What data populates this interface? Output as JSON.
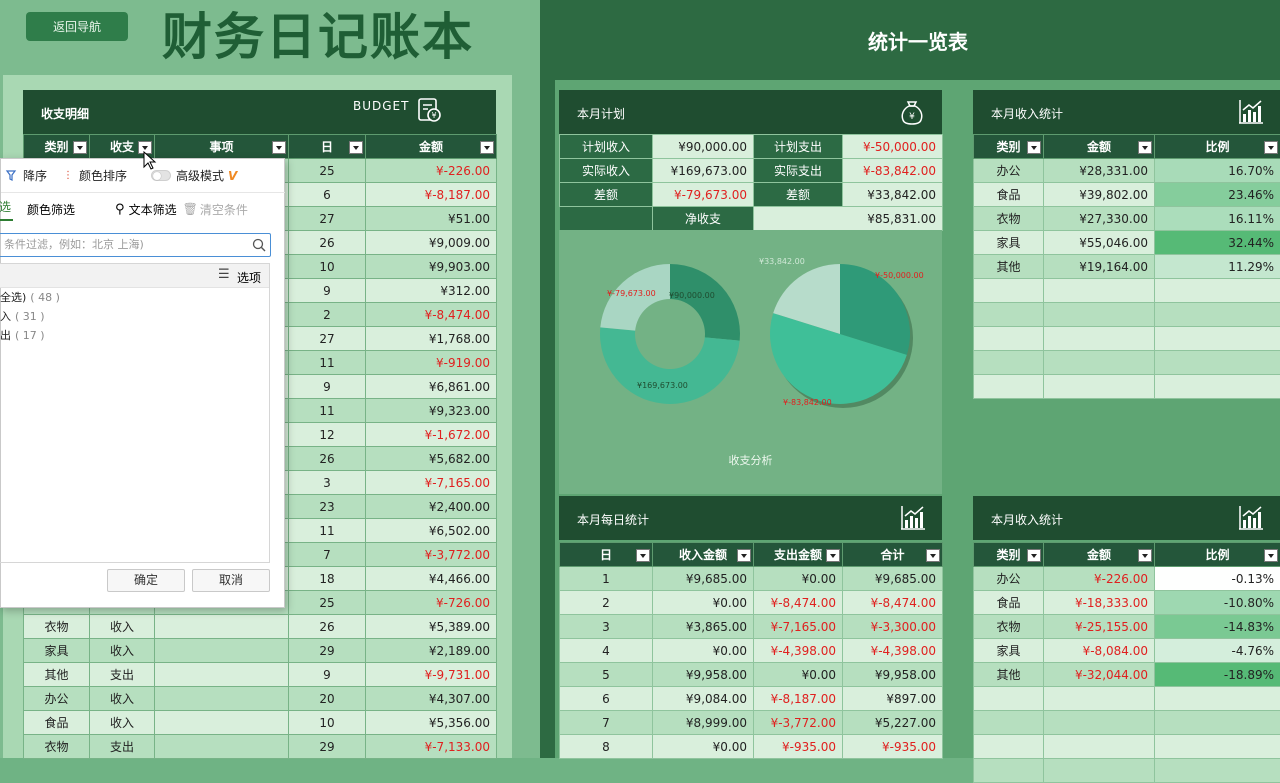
{
  "header": {
    "back_button": "返回导航",
    "title": "财务日记账本"
  },
  "ledger": {
    "section_title": "收支明细",
    "badge": "BUDGET",
    "columns": [
      "类别",
      "收支",
      "事项",
      "日",
      "金额"
    ],
    "rows": [
      {
        "c": "",
        "t": "",
        "day": "25",
        "amt": "¥-226.00"
      },
      {
        "c": "",
        "t": "",
        "day": "6",
        "amt": "¥-8,187.00"
      },
      {
        "c": "",
        "t": "",
        "day": "27",
        "amt": "¥51.00"
      },
      {
        "c": "",
        "t": "",
        "day": "26",
        "amt": "¥9,009.00"
      },
      {
        "c": "",
        "t": "",
        "day": "10",
        "amt": "¥9,903.00"
      },
      {
        "c": "",
        "t": "",
        "day": "9",
        "amt": "¥312.00"
      },
      {
        "c": "",
        "t": "",
        "day": "2",
        "amt": "¥-8,474.00"
      },
      {
        "c": "",
        "t": "",
        "day": "27",
        "amt": "¥1,768.00"
      },
      {
        "c": "",
        "t": "",
        "day": "11",
        "amt": "¥-919.00"
      },
      {
        "c": "",
        "t": "",
        "day": "9",
        "amt": "¥6,861.00"
      },
      {
        "c": "",
        "t": "",
        "day": "11",
        "amt": "¥9,323.00"
      },
      {
        "c": "",
        "t": "",
        "day": "12",
        "amt": "¥-1,672.00"
      },
      {
        "c": "",
        "t": "",
        "day": "26",
        "amt": "¥5,682.00"
      },
      {
        "c": "",
        "t": "",
        "day": "3",
        "amt": "¥-7,165.00"
      },
      {
        "c": "",
        "t": "",
        "day": "23",
        "amt": "¥2,400.00"
      },
      {
        "c": "",
        "t": "",
        "day": "11",
        "amt": "¥6,502.00"
      },
      {
        "c": "",
        "t": "",
        "day": "7",
        "amt": "¥-3,772.00"
      },
      {
        "c": "",
        "t": "",
        "day": "18",
        "amt": "¥4,466.00"
      },
      {
        "c": "",
        "t": "",
        "day": "25",
        "amt": "¥-726.00"
      },
      {
        "c": "衣物",
        "t": "收入",
        "day": "26",
        "amt": "¥5,389.00"
      },
      {
        "c": "家具",
        "t": "收入",
        "day": "29",
        "amt": "¥2,189.00"
      },
      {
        "c": "其他",
        "t": "支出",
        "day": "9",
        "amt": "¥-9,731.00"
      },
      {
        "c": "办公",
        "t": "收入",
        "day": "20",
        "amt": "¥4,307.00"
      },
      {
        "c": "食品",
        "t": "收入",
        "day": "10",
        "amt": "¥5,356.00"
      },
      {
        "c": "衣物",
        "t": "支出",
        "day": "29",
        "amt": "¥-7,133.00"
      }
    ]
  },
  "filter_popup": {
    "sort_desc": "降序",
    "color_sort": "颜色排序",
    "advanced": "高级模式",
    "content_tab": "选",
    "color_filter": "颜色筛选",
    "text_filter": "文本筛选",
    "clear": "清空条件",
    "search_placeholder": "条件过滤，例如：北京 上海)",
    "options_label": "选项",
    "items": [
      {
        "label": "全选)",
        "count": "( 48 )"
      },
      {
        "label": "入",
        "count": "( 31 )"
      },
      {
        "label": "出",
        "count": "( 17 )"
      }
    ],
    "ok": "确定",
    "cancel": "取消"
  },
  "stats": {
    "title": "统计一览表",
    "plan": {
      "title": "本月计划",
      "rows": [
        {
          "l1": "计划收入",
          "v1": "¥90,000.00",
          "l2": "计划支出",
          "v2": "¥-50,000.00"
        },
        {
          "l1": "实际收入",
          "v1": "¥169,673.00",
          "l2": "实际支出",
          "v2": "¥-83,842.00"
        },
        {
          "l1": "差额",
          "v1": "¥-79,673.00",
          "l2": "差额",
          "v2": "¥33,842.00"
        }
      ],
      "net_label": "净收支",
      "net_value": "¥85,831.00"
    },
    "chart_caption": "收支分析",
    "income1": {
      "title": "本月收入统计",
      "columns": [
        "类别",
        "金额",
        "比例"
      ],
      "rows": [
        {
          "c": "办公",
          "a": "¥28,331.00",
          "p": "16.70%"
        },
        {
          "c": "食品",
          "a": "¥39,802.00",
          "p": "23.46%"
        },
        {
          "c": "衣物",
          "a": "¥27,330.00",
          "p": "16.11%"
        },
        {
          "c": "家具",
          "a": "¥55,046.00",
          "p": "32.44%"
        },
        {
          "c": "其他",
          "a": "¥19,164.00",
          "p": "11.29%"
        }
      ]
    },
    "daily": {
      "title": "本月每日统计",
      "columns": [
        "日",
        "收入金额",
        "支出金额",
        "合计"
      ],
      "rows": [
        {
          "d": "1",
          "i": "¥9,685.00",
          "e": "¥0.00",
          "s": "¥9,685.00"
        },
        {
          "d": "2",
          "i": "¥0.00",
          "e": "¥-8,474.00",
          "s": "¥-8,474.00"
        },
        {
          "d": "3",
          "i": "¥3,865.00",
          "e": "¥-7,165.00",
          "s": "¥-3,300.00"
        },
        {
          "d": "4",
          "i": "¥0.00",
          "e": "¥-4,398.00",
          "s": "¥-4,398.00"
        },
        {
          "d": "5",
          "i": "¥9,958.00",
          "e": "¥0.00",
          "s": "¥9,958.00"
        },
        {
          "d": "6",
          "i": "¥9,084.00",
          "e": "¥-8,187.00",
          "s": "¥897.00"
        },
        {
          "d": "7",
          "i": "¥8,999.00",
          "e": "¥-3,772.00",
          "s": "¥5,227.00"
        },
        {
          "d": "8",
          "i": "¥0.00",
          "e": "¥-935.00",
          "s": "¥-935.00"
        }
      ]
    },
    "income2": {
      "title": "本月收入统计",
      "columns": [
        "类别",
        "金额",
        "比例"
      ],
      "rows": [
        {
          "c": "办公",
          "a": "¥-226.00",
          "p": "-0.13%"
        },
        {
          "c": "食品",
          "a": "¥-18,333.00",
          "p": "-10.80%"
        },
        {
          "c": "衣物",
          "a": "¥-25,155.00",
          "p": "-14.83%"
        },
        {
          "c": "家具",
          "a": "¥-8,084.00",
          "p": "-4.76%"
        },
        {
          "c": "其他",
          "a": "¥-32,044.00",
          "p": "-18.89%"
        }
      ]
    }
  },
  "chart_data": [
    {
      "type": "pie",
      "labels": [
        "¥90,000.00",
        "¥169,673.00",
        "¥-79,673.00"
      ],
      "values": [
        90000,
        169673,
        79673
      ]
    },
    {
      "type": "pie",
      "labels": [
        "¥-50,000.00",
        "¥-83,842.00",
        "¥33,842.00"
      ],
      "values": [
        50000,
        83842,
        33842
      ]
    }
  ]
}
